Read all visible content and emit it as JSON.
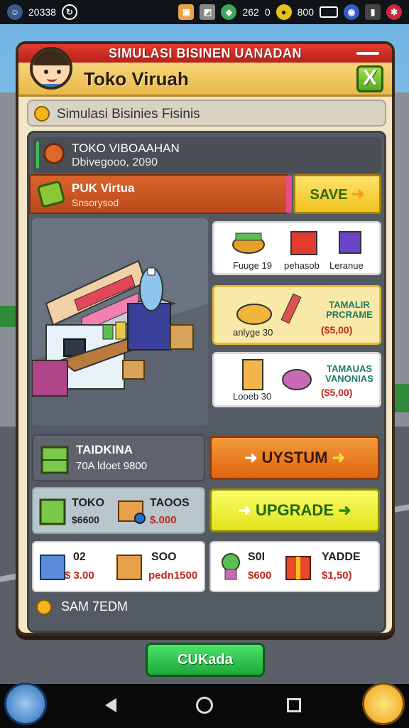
{
  "status_bar": {
    "time": "20338",
    "left_icon": "0",
    "center": "262",
    "number_right": "800",
    "icons": [
      "clock-icon",
      "notification-icon",
      "gps-icon",
      "signal-icon",
      "battery-icon"
    ]
  },
  "panel": {
    "top_banner": "SIMULASI BISINEN UANADAN",
    "title": "Toko Viruah",
    "close_label": "X",
    "subtitle": "Simulasi Bisinies Fisinis"
  },
  "shop": {
    "name": "TOKO VIBOAAHAN",
    "value": "Dbivegooo, 2090"
  },
  "product": {
    "name": "PUK Virtua",
    "sub": "Snsorysod",
    "save_label": "SAVE"
  },
  "item_cards": [
    {
      "labels": [
        "Fuuge 19",
        "pehasob",
        "Leranue"
      ]
    },
    {
      "label": "anlyge 30",
      "info": "TAMALIR\nPRCRAME",
      "price": "($5,00)"
    },
    {
      "label": "Looeb 30",
      "info": "TAMAUAS\nVANONIAS",
      "price": "($5,00)"
    }
  ],
  "stats": {
    "name": "TAIDKINA",
    "value": "70A ldoet 9800"
  },
  "actions": {
    "system_label": "UYSTUM",
    "upgrade_label": "UPGRADE"
  },
  "toko_card": {
    "name": "TOKO",
    "price": "$6600",
    "name2": "TAOOS",
    "price2": "$.000"
  },
  "mini_cards": [
    {
      "name": "02",
      "price": "$ 3.00"
    },
    {
      "name": "SOO",
      "price": "pedn1500"
    },
    {
      "name": "S0I",
      "price": "$600"
    },
    {
      "name": "YADDE",
      "price": "$1,50)"
    }
  ],
  "footer_row": "SAM 7EDM",
  "bottom_button": "CUKada",
  "colors": {
    "panel_bg": "#f3e6c6",
    "banner_red": "#e23b2f",
    "header_yellow": "#f6d57a",
    "system_orange": "#e06512",
    "upgrade_yellow": "#e2e31a",
    "bottom_green": "#1ea93a"
  }
}
